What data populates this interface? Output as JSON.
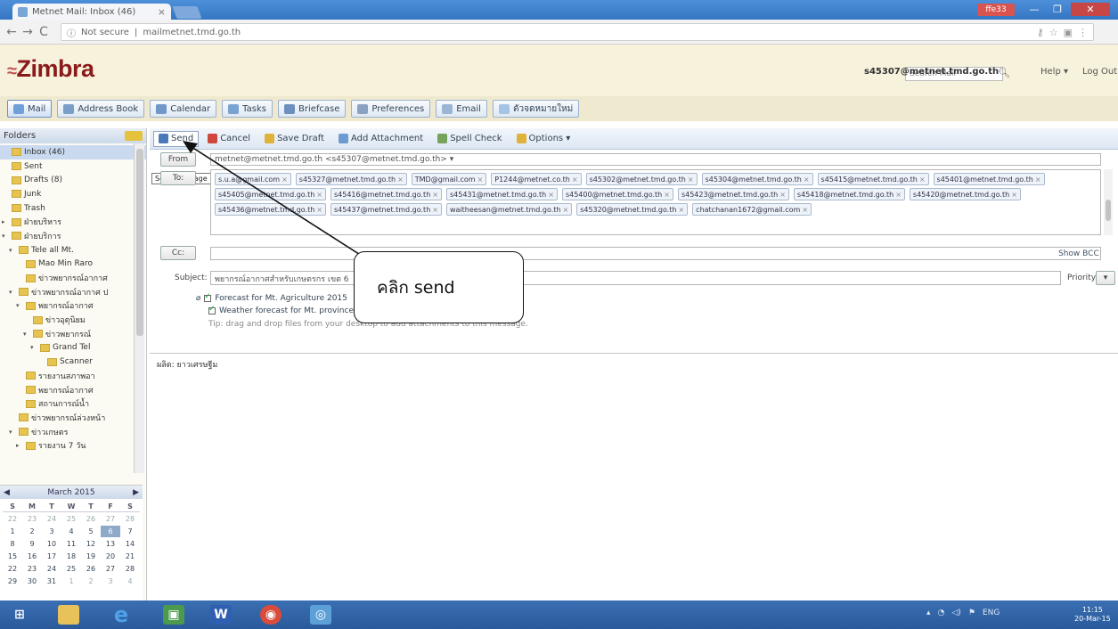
{
  "browser": {
    "tab_title": "Metnet Mail: Inbox (46)",
    "tab_close": "×",
    "url_prefix": "Not secure",
    "url_text": "mailmetnet.tmd.go.th",
    "window_user": "ffe33",
    "win_min": "—",
    "win_max": "❐",
    "win_close": "✕"
  },
  "header": {
    "logo": "Zimbra",
    "search_placeholder": "Search Mail",
    "user": "s45307@metnet.tmd.go.th",
    "help": "Help ▾",
    "logout": "Log Out"
  },
  "apptabs": [
    {
      "label": "Mail",
      "color": "#6fa0d8"
    },
    {
      "label": "Address Book",
      "color": "#7a9ec8"
    },
    {
      "label": "Calendar",
      "color": "#6f98c9"
    },
    {
      "label": "Tasks",
      "color": "#7aa3d2"
    },
    {
      "label": "Briefcase",
      "color": "#6c8fbd"
    },
    {
      "label": "Preferences",
      "color": "#8aa2c2"
    },
    {
      "label": "Email",
      "color": "#9bb6d5"
    },
    {
      "label": "ตัวจดหมายใหม่",
      "color": "#a5c3e4"
    }
  ],
  "leftpane": {
    "folders_title": "Folders",
    "folders": [
      {
        "label": "Inbox (46)",
        "indent": 0,
        "tw": ""
      },
      {
        "label": "Sent",
        "indent": 0,
        "tw": ""
      },
      {
        "label": "Drafts (8)",
        "indent": 0,
        "tw": ""
      },
      {
        "label": "Junk",
        "indent": 0,
        "tw": ""
      },
      {
        "label": "Trash",
        "indent": 0,
        "tw": ""
      },
      {
        "label": "ฝ่ายบริหาร",
        "indent": 0,
        "tw": "▸"
      },
      {
        "label": "ฝ่ายบริการ",
        "indent": 0,
        "tw": "▾"
      },
      {
        "label": "Tele all Mt.",
        "indent": 1,
        "tw": "▾"
      },
      {
        "label": "Mao Min Raro",
        "indent": 2,
        "tw": ""
      },
      {
        "label": "ข่าวพยากรณ์อากาศ",
        "indent": 2,
        "tw": ""
      },
      {
        "label": "ข่าวพยากรณ์อากาศ ป",
        "indent": 1,
        "tw": "▾"
      },
      {
        "label": "พยากรณ์อากาศ",
        "indent": 2,
        "tw": "▾"
      },
      {
        "label": "ข่าวอุตุนิยม",
        "indent": 3,
        "tw": ""
      },
      {
        "label": "ข่าวพยากรณ์",
        "indent": 3,
        "tw": "▾"
      },
      {
        "label": "Grand Tel",
        "indent": 4,
        "tw": "▾"
      },
      {
        "label": "Scanner",
        "indent": 5,
        "tw": ""
      },
      {
        "label": "รายงานสภาพอา",
        "indent": 2,
        "tw": ""
      },
      {
        "label": "พยากรณ์อากาศ",
        "indent": 2,
        "tw": ""
      },
      {
        "label": "สถานการณ์น้ำ",
        "indent": 2,
        "tw": ""
      },
      {
        "label": "ข่าวพยากรณ์ล่วงหน้า",
        "indent": 1,
        "tw": ""
      },
      {
        "label": "ข่าวเกษตร",
        "indent": 1,
        "tw": "▾"
      },
      {
        "label": "รายงาน 7 วัน",
        "indent": 2,
        "tw": "▸"
      }
    ],
    "calendar": {
      "month": "March 2015",
      "prev": "◀",
      "next": "▶",
      "dows": [
        "S",
        "M",
        "T",
        "W",
        "T",
        "F",
        "S"
      ],
      "days": [
        "22",
        "23",
        "24",
        "25",
        "26",
        "27",
        "28",
        "1",
        "2",
        "3",
        "4",
        "5",
        "6",
        "7",
        "8",
        "9",
        "10",
        "11",
        "12",
        "13",
        "14",
        "15",
        "16",
        "17",
        "18",
        "19",
        "20",
        "21",
        "22",
        "23",
        "24",
        "25",
        "26",
        "27",
        "28",
        "29",
        "30",
        "31",
        "1",
        "2",
        "3",
        "4"
      ],
      "today_index": 12
    }
  },
  "compose": {
    "toolbar": [
      {
        "label": "Send",
        "color": "#4a78b8"
      },
      {
        "label": "Cancel",
        "color": "#d0473e"
      },
      {
        "label": "Save Draft",
        "color": "#e1b23a"
      },
      {
        "label": "Add Attachment",
        "color": "#6b9bd0"
      },
      {
        "label": "Spell Check",
        "color": "#75a35a"
      },
      {
        "label": "Options ▾",
        "color": "#e1b23a"
      }
    ],
    "tooltip": "Send message",
    "from_label": "From",
    "from_value": "metnet@metnet.tmd.go.th <s45307@metnet.tmd.go.th>  ▾",
    "to_label": "To:",
    "recipients": [
      "s.u.a@gmail.com",
      "s45327@metnet.tmd.go.th",
      "TMD@gmail.com",
      "P1244@metnet.co.th",
      "s45302@metnet.tmd.go.th",
      "s45304@metnet.tmd.go.th",
      "s45415@metnet.tmd.go.th",
      "s45401@metnet.tmd.go.th",
      "s45405@metnet.tmd.go.th",
      "s45416@metnet.tmd.go.th",
      "s45431@metnet.tmd.go.th",
      "s45400@metnet.tmd.go.th",
      "s45423@metnet.tmd.go.th",
      "s45418@metnet.tmd.go.th",
      "s45420@metnet.tmd.go.th",
      "s45436@metnet.tmd.go.th",
      "s45437@metnet.tmd.go.th",
      "waitheesan@metnet.tmd.go.th",
      "s45320@metnet.tmd.go.th",
      "chatchanan1672@gmail.com"
    ],
    "cc_label": "Cc:",
    "show_bcc": "Show BCC",
    "subject_label": "Subject:",
    "subject_value": "พยากรณ์อากาศสำหรับเกษตรกร เขต 6",
    "priority_label": "Priority:",
    "attachments": [
      "Forecast for Mt. Agriculture 2015",
      "Weather forecast for Mt. province"
    ],
    "drag_hint": "Tip: drag and drop files from your desktop to add attachments to this message.",
    "body_text": "ผลิต: ยาวเศรษฐีม"
  },
  "callout": {
    "text": "คลิก send"
  },
  "taskbar": {
    "clock_time": "11:15",
    "clock_date": "20-Mar-15",
    "tray": "ENG"
  }
}
